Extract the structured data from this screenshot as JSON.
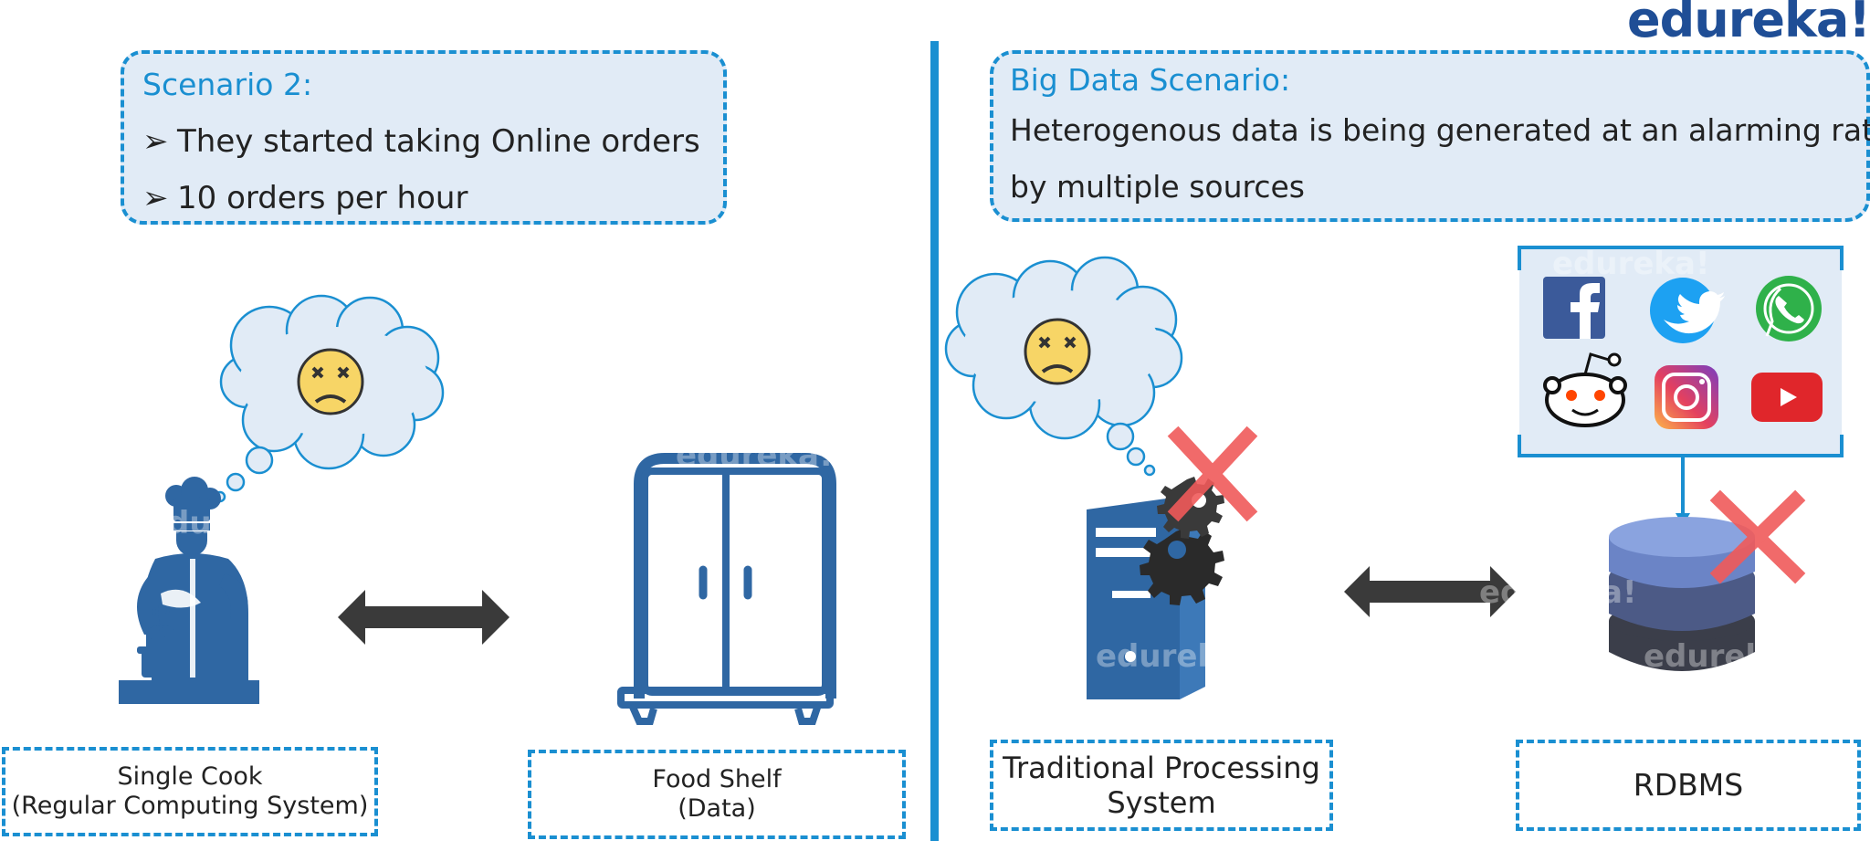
{
  "brand": {
    "logo_text": "edureka!"
  },
  "left": {
    "scenario": {
      "title": "Scenario 2:",
      "bullets": [
        "They started taking Online orders",
        "10 orders per hour"
      ],
      "bullet_glyph": "➢"
    },
    "cook_label": {
      "line1": "Single Cook",
      "line2": "(Regular Computing System)"
    },
    "shelf_label": {
      "line1": "Food Shelf",
      "line2": "(Data)"
    }
  },
  "right": {
    "scenario": {
      "title": "Big Data Scenario:",
      "line1": "Heterogenous data is being generated at an alarming rate",
      "line2": "by multiple sources"
    },
    "system_label": {
      "line1": "Traditional Processing",
      "line2": "System"
    },
    "rdbms_label": {
      "text": "RDBMS"
    }
  },
  "icons": [
    "cook-icon",
    "thought-cloud-icon",
    "sad-face-icon",
    "double-arrow-icon",
    "cabinet-icon",
    "server-icon",
    "gear-icon",
    "cross-icon",
    "database-icon",
    "facebook-icon",
    "twitter-icon",
    "whatsapp-icon",
    "reddit-icon",
    "instagram-icon",
    "youtube-icon"
  ],
  "colors": {
    "accent": "#1a8fd1",
    "brand": "#1f4e96",
    "icon_blue": "#2f67a3",
    "cross": "#f05a5a",
    "cloud_fill": "#e1ebf6",
    "face": "#f7d566"
  }
}
